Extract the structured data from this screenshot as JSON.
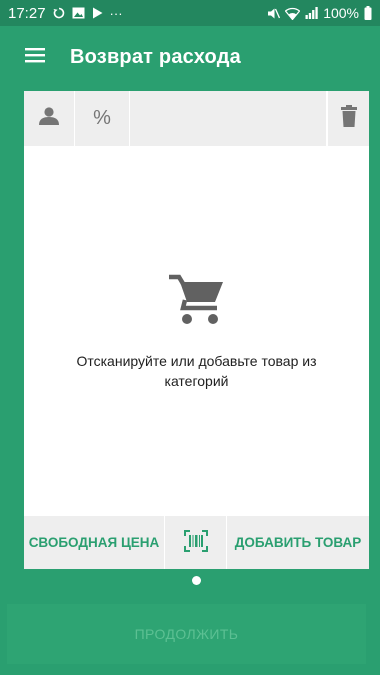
{
  "status_bar": {
    "time": "17:27",
    "battery": "100%",
    "icons": [
      "sync-icon",
      "image-icon",
      "play-store-icon",
      "more-icon",
      "mute-icon",
      "wifi-icon",
      "signal-icon",
      "battery-icon"
    ],
    "more": "···"
  },
  "app_bar": {
    "title": "Возврат расхода",
    "menu_icon": "hamburger-icon"
  },
  "toolbar": {
    "user_icon": "person-icon",
    "discount_label": "%",
    "delete_icon": "trash-icon"
  },
  "empty_state": {
    "icon": "cart-icon",
    "message": "Отсканируйте или добавьте товар из категорий"
  },
  "actions": {
    "free_price_label": "СВОБОДНАЯ ЦЕНА",
    "scan_icon": "barcode-scan-icon",
    "add_item_label": "ДОБАВИТЬ ТОВАР"
  },
  "continue_label": "ПРОДОЛЖИТЬ",
  "colors": {
    "primary": "#2a9f70",
    "status_bar": "#23875f",
    "surface": "#ffffff",
    "toolbar_bg": "#eeeeee",
    "icon_grey": "#757575",
    "cart_grey": "#616161"
  }
}
